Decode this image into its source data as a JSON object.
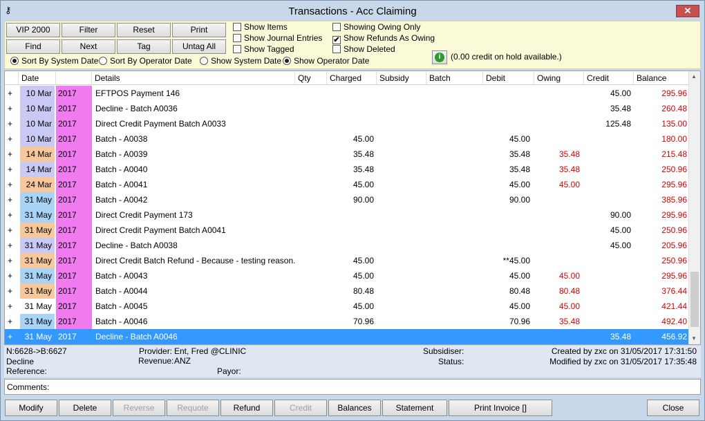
{
  "window": {
    "title": "Transactions - Acc Claiming",
    "close_label": "✕"
  },
  "toolbar": {
    "buttons": [
      "VIP 2000",
      "Filter",
      "Reset",
      "Print",
      "Find",
      "Next",
      "Tag",
      "Untag All"
    ],
    "checkboxes": [
      {
        "label": "Show Items",
        "checked": false
      },
      {
        "label": "Show Journal Entries",
        "checked": false
      },
      {
        "label": "Show Tagged",
        "checked": false
      },
      {
        "label": "Showing Owing Only",
        "checked": false
      },
      {
        "label": "Show Refunds As Owing",
        "checked": true
      },
      {
        "label": "Show Deleted",
        "checked": false
      }
    ],
    "sort_radios": [
      {
        "label": "Sort By System Date",
        "on": true
      },
      {
        "label": "Sort By Operator Date",
        "on": false
      },
      {
        "label": "Show System Date",
        "on": false
      },
      {
        "label": "Show Operator Date",
        "on": true
      }
    ],
    "credit_note": "(0.00 credit on hold available.)",
    "check_mark": "✔"
  },
  "grid": {
    "headers": [
      "Date",
      "Details",
      "Qty",
      "Charged",
      "Subsidy",
      "Batch",
      "Debit",
      "Owing",
      "Credit",
      "Balance"
    ],
    "rows": [
      {
        "exp": "+",
        "date": "10 Mar",
        "year": "2017",
        "details": "EFTPOS Payment  146",
        "charged": "",
        "debit": "",
        "owing": "",
        "credit": "45.00",
        "balance": "295.96",
        "dc": "#c9c9f5"
      },
      {
        "exp": "+",
        "date": "10 Mar",
        "year": "2017",
        "details": "Decline - Batch A0036",
        "charged": "",
        "debit": "",
        "owing": "",
        "credit": "35.48",
        "balance": "260.48",
        "dc": "#c9c9f5"
      },
      {
        "exp": "+",
        "date": "10 Mar",
        "year": "2017",
        "details": "Direct Credit Payment   Batch A0033",
        "charged": "",
        "debit": "",
        "owing": "",
        "credit": "125.48",
        "balance": "135.00",
        "dc": "#c9c9f5"
      },
      {
        "exp": "+",
        "date": "10 Mar",
        "year": "2017",
        "details": "Batch - A0038",
        "charged": "45.00",
        "debit": "45.00",
        "owing": "",
        "credit": "",
        "balance": "180.00",
        "dc": "#c9c9f5"
      },
      {
        "exp": "+",
        "date": "14 Mar",
        "year": "2017",
        "details": "Batch - A0039",
        "charged": "35.48",
        "debit": "35.48",
        "owing": "35.48",
        "credit": "",
        "balance": "215.48",
        "dc": "#f6c89b"
      },
      {
        "exp": "+",
        "date": "14 Mar",
        "year": "2017",
        "details": "Batch - A0040",
        "charged": "35.48",
        "debit": "35.48",
        "owing": "35.48",
        "credit": "",
        "balance": "250.96",
        "dc": "#c9c9f5"
      },
      {
        "exp": "+",
        "date": "24 Mar",
        "year": "2017",
        "details": "Batch - A0041",
        "charged": "45.00",
        "debit": "45.00",
        "owing": "45.00",
        "credit": "",
        "balance": "295.96",
        "dc": "#f6c89b"
      },
      {
        "exp": "+",
        "date": "31 May",
        "year": "2017",
        "details": "Batch - A0042",
        "charged": "90.00",
        "debit": "90.00",
        "owing": "",
        "credit": "",
        "balance": "385.96",
        "dc": "#a9d3f7"
      },
      {
        "exp": "+",
        "date": "31 May",
        "year": "2017",
        "details": "Direct Credit Payment  173",
        "charged": "",
        "debit": "",
        "owing": "",
        "credit": "90.00",
        "balance": "295.96",
        "dc": "#a9d3f7"
      },
      {
        "exp": "+",
        "date": "31 May",
        "year": "2017",
        "details": "Direct Credit Payment   Batch A0041",
        "charged": "",
        "debit": "",
        "owing": "",
        "credit": "45.00",
        "balance": "250.96",
        "dc": "#f6c89b"
      },
      {
        "exp": "+",
        "date": "31 May",
        "year": "2017",
        "details": "Decline - Batch A0038",
        "charged": "",
        "debit": "",
        "owing": "",
        "credit": "45.00",
        "balance": "205.96",
        "dc": "#c9c9f5"
      },
      {
        "exp": "+",
        "date": "31 May",
        "year": "2017",
        "details": "Direct Credit Batch Refund - Because - testing reason.",
        "charged": "45.00",
        "debit": "**45.00",
        "owing": "",
        "credit": "",
        "balance": "250.96",
        "dc": "#f6c89b"
      },
      {
        "exp": "+",
        "date": "31 May",
        "year": "2017",
        "details": "Batch - A0043",
        "charged": "45.00",
        "debit": "45.00",
        "owing": "45.00",
        "credit": "",
        "balance": "295.96",
        "dc": "#a9d3f7"
      },
      {
        "exp": "+",
        "date": "31 May",
        "year": "2017",
        "details": "Batch - A0044",
        "charged": "80.48",
        "debit": "80.48",
        "owing": "80.48",
        "credit": "",
        "balance": "376.44",
        "dc": "#f6c89b"
      },
      {
        "exp": "+",
        "date": "31 May",
        "year": "2017",
        "details": "Batch - A0045",
        "charged": "45.00",
        "debit": "45.00",
        "owing": "45.00",
        "credit": "",
        "balance": "421.44",
        "dc": "#ffffff"
      },
      {
        "exp": "+",
        "date": "31 May",
        "year": "2017",
        "details": "Batch - A0046",
        "charged": "70.96",
        "debit": "70.96",
        "owing": "35.48",
        "credit": "",
        "balance": "492.40",
        "dc": "#a9d3f7"
      },
      {
        "exp": "+",
        "date": "31 May",
        "year": "2017",
        "details": "Decline - Batch A0046",
        "charged": "",
        "debit": "",
        "owing": "",
        "credit": "35.48",
        "balance": "456.92",
        "dc": "#3399ff",
        "selected": true
      }
    ]
  },
  "detail": {
    "nb": "N:6628->B:6627",
    "decline": "Decline",
    "reference_label": "Reference:",
    "provider_label": "Provider:",
    "provider_value": "Ent, Fred @CLINIC",
    "revenue_label": "Revenue:",
    "revenue_value": "ANZ",
    "payor_label": "Payor:",
    "subsidiser_label": "Subsidiser:",
    "status_label": "Status:",
    "created": "Created by zxc on 31/05/2017 17:31:50",
    "modified": "Modified by zxc on 31/05/2017 17:35:48"
  },
  "comments": {
    "label": "Comments:"
  },
  "bottom_buttons": [
    {
      "label": "Modify",
      "enabled": true
    },
    {
      "label": "Delete",
      "enabled": true
    },
    {
      "label": "Reverse",
      "enabled": false
    },
    {
      "label": "Requote",
      "enabled": false
    },
    {
      "label": "Refund",
      "enabled": true
    },
    {
      "label": "Credit",
      "enabled": false
    },
    {
      "label": "Balances",
      "enabled": true
    },
    {
      "label": "Statement",
      "enabled": true
    },
    {
      "label": "Print Invoice []",
      "enabled": true
    },
    {
      "label": "Close",
      "enabled": true
    }
  ],
  "colors": {
    "year_cell": "#f07af0",
    "negative": "#d40000",
    "selected_row": "#3399ff",
    "toolbar_bg": "#fbfad8"
  }
}
